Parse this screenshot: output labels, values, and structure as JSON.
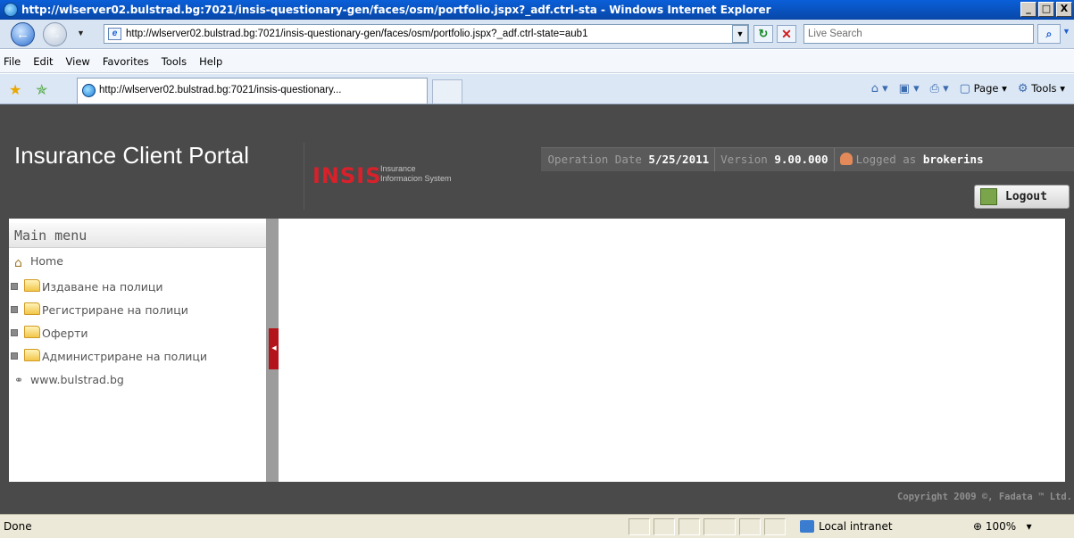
{
  "window": {
    "title": "http://wlserver02.bulstrad.bg:7021/insis-questionary-gen/faces/osm/portfolio.jspx?_adf.ctrl-sta - Windows Internet Explorer",
    "buttons": [
      "_",
      "□",
      "X"
    ]
  },
  "address_bar": {
    "url": "http://wlserver02.bulstrad.bg:7021/insis-questionary-gen/faces/osm/portfolio.jspx?_adf.ctrl-state=aub1",
    "search_placeholder": "Live Search"
  },
  "menu_bar": {
    "items": [
      "File",
      "Edit",
      "View",
      "Favorites",
      "Tools",
      "Help"
    ]
  },
  "tab": {
    "title": "http://wlserver02.bulstrad.bg:7021/insis-questionary..."
  },
  "command_bar": {
    "page_label": "Page",
    "tools_label": "Tools"
  },
  "app": {
    "title": "Insurance Client Portal",
    "logo_text": "INSIS",
    "logo_subtitle_line1": "Insurance",
    "logo_subtitle_line2": "Informacion System",
    "operation_date_label": "Operation Date",
    "operation_date": "5/25/2011",
    "version_label": "Version",
    "version": "9.00.000",
    "logged_as_label": "Logged as",
    "user": "brokerins",
    "logout_label": "Logout"
  },
  "sidebar": {
    "title": "Main menu",
    "items": [
      {
        "label": "Home",
        "icon": "home-icon"
      },
      {
        "label": "Издаване на полици",
        "icon": "folder-icon"
      },
      {
        "label": "Регистриране на полици",
        "icon": "folder-icon"
      },
      {
        "label": "Оферти",
        "icon": "folder-icon"
      },
      {
        "label": "Администриране на полици",
        "icon": "folder-icon"
      },
      {
        "label": "www.bulstrad.bg",
        "icon": "link-icon"
      }
    ]
  },
  "footer": {
    "copyright": "Copyright 2009 ©, Fadata ™ Ltd."
  },
  "status_bar": {
    "status": "Done",
    "zone": "Local intranet",
    "zoom": "100%"
  }
}
